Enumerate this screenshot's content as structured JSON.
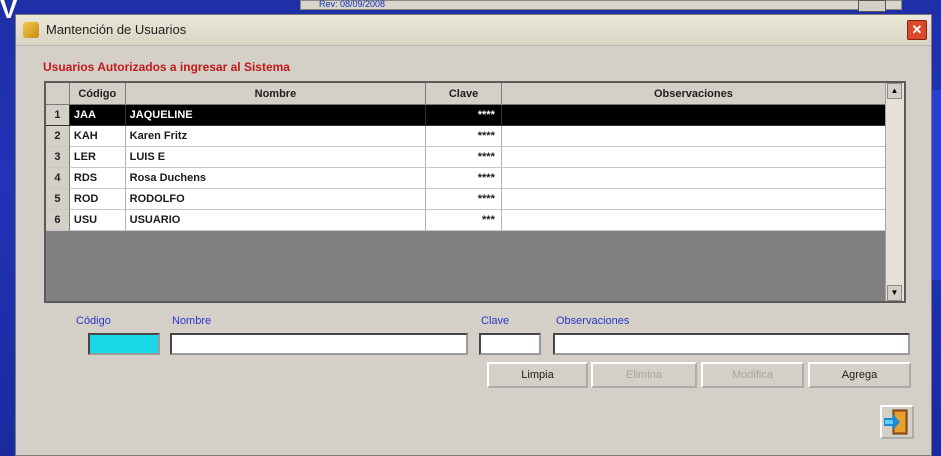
{
  "background": {
    "rev_label": "Rev: 08/09/2008",
    "letter": "V"
  },
  "window": {
    "title": "Mantención de Usuarios",
    "close_glyph": "✕"
  },
  "group_label": "Usuarios Autorizados a ingresar al Sistema",
  "grid": {
    "columns": [
      "",
      "Código",
      "Nombre",
      "Clave",
      "Observaciones"
    ],
    "rows": [
      {
        "num": "1",
        "codigo": "JAA",
        "nombre": "JAQUELINE",
        "clave": "****",
        "obs": ""
      },
      {
        "num": "2",
        "codigo": "KAH",
        "nombre": "Karen Fritz",
        "clave": "****",
        "obs": ""
      },
      {
        "num": "3",
        "codigo": "LER",
        "nombre": "LUIS E",
        "clave": "****",
        "obs": ""
      },
      {
        "num": "4",
        "codigo": "RDS",
        "nombre": "Rosa Duchens",
        "clave": "****",
        "obs": ""
      },
      {
        "num": "5",
        "codigo": "ROD",
        "nombre": "RODOLFO",
        "clave": "****",
        "obs": ""
      },
      {
        "num": "6",
        "codigo": "USU",
        "nombre": "USUARIO",
        "clave": "***",
        "obs": ""
      }
    ],
    "selected_row": 0,
    "scroll_up": "▲",
    "scroll_down": "▼"
  },
  "form": {
    "codigo_label": "Código",
    "nombre_label": "Nombre",
    "clave_label": "Clave",
    "obs_label": "Observaciones",
    "codigo_value": "",
    "nombre_value": "",
    "clave_value": "",
    "obs_value": ""
  },
  "buttons": {
    "limpia": "Limpia",
    "elimina": "Elimina",
    "modifica": "Modifica",
    "agrega": "Agrega"
  },
  "colors": {
    "accent_label": "#c0191a",
    "field_label": "#2438c8",
    "codigo_fill": "#19d8e8"
  }
}
